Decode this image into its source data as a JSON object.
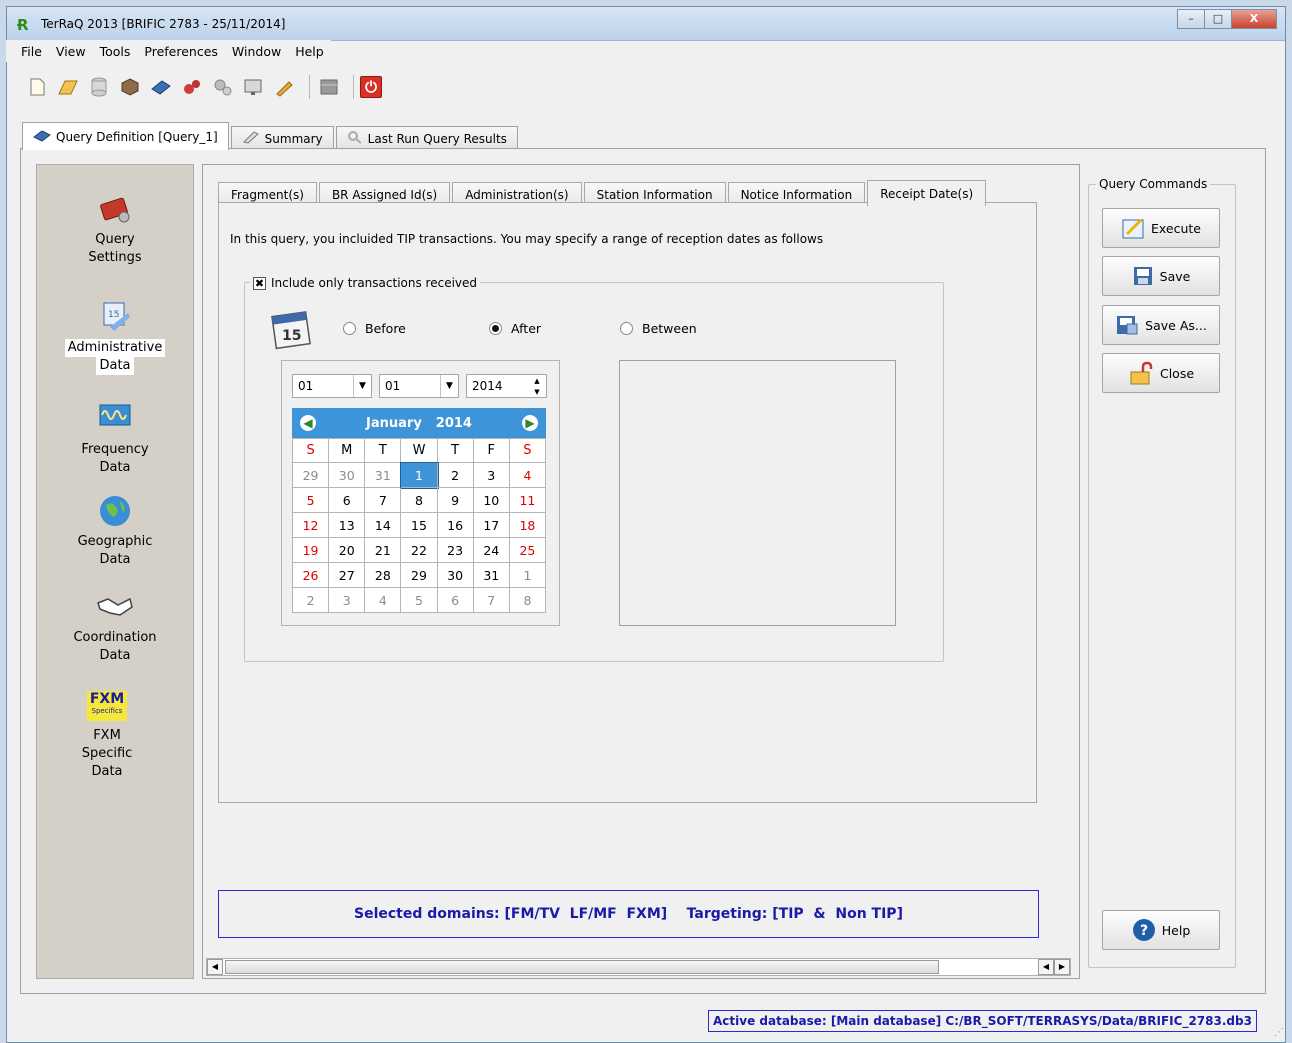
{
  "window": {
    "title": "TerRaQ 2013 [BRIFIC 2783 - 25/11/2014]",
    "controls": [
      "–",
      "□",
      "X"
    ]
  },
  "menu": [
    "File",
    "View",
    "Tools",
    "Preferences",
    "Window",
    "Help"
  ],
  "toolbar_icons": [
    "new-file-icon",
    "open-folder-icon",
    "database-icon",
    "cube-icon",
    "blue-query-icon",
    "red-tools-icon",
    "gears-icon",
    "monitor-icon",
    "pen-icon",
    "grid-icon",
    "power-icon"
  ],
  "main_tabs": [
    {
      "label": "Query Definition [Query_1]",
      "icon": "query-icon"
    },
    {
      "label": "Summary",
      "icon": "summary-icon"
    },
    {
      "label": "Last Run Query Results",
      "icon": "results-icon"
    }
  ],
  "sidebar": {
    "items": [
      {
        "label1": "Query",
        "label2": "Settings"
      },
      {
        "label1": "Administrative",
        "label2": "Data"
      },
      {
        "label1": "Frequency",
        "label2": "Data"
      },
      {
        "label1": "Geographic",
        "label2": "Data"
      },
      {
        "label1": "Coordination",
        "label2": "Data"
      },
      {
        "label1": "FXM",
        "label2": "Specific",
        "label3": "Data",
        "logo": "FXM",
        "logo_sub": "Specifics"
      }
    ]
  },
  "sub_tabs": [
    "Fragment(s)",
    "BR Assigned Id(s)",
    "Administration(s)",
    "Station Information",
    "Notice Information",
    "Receipt Date(s)"
  ],
  "receipt": {
    "intro": "In this query, you incluided TIP transactions. You may specify a range of reception dates as follows",
    "include_label": "Include only transactions received",
    "include_checked": "✖",
    "calendar_icon_text": "15",
    "options": [
      "Before",
      "After",
      "Between"
    ],
    "selected_option": "After",
    "day_combo": "01",
    "month_combo": "01",
    "year_spin": "2014"
  },
  "calendar": {
    "month": "January",
    "year": "2014",
    "weekdays": [
      "S",
      "M",
      "T",
      "W",
      "T",
      "F",
      "S"
    ],
    "weeks": [
      [
        "29",
        "30",
        "31",
        "1",
        "2",
        "3",
        "4"
      ],
      [
        "5",
        "6",
        "7",
        "8",
        "9",
        "10",
        "11"
      ],
      [
        "12",
        "13",
        "14",
        "15",
        "16",
        "17",
        "18"
      ],
      [
        "19",
        "20",
        "21",
        "22",
        "23",
        "24",
        "25"
      ],
      [
        "26",
        "27",
        "28",
        "29",
        "30",
        "31",
        "1"
      ],
      [
        "2",
        "3",
        "4",
        "5",
        "6",
        "7",
        "8"
      ]
    ],
    "selected_day": "1"
  },
  "status": {
    "domains": "Selected domains: [FM/TV  LF/MF  FXM]    Targeting: [TIP  &  Non TIP]"
  },
  "commands": {
    "legend": "Query Commands",
    "execute": "Execute",
    "save": "Save",
    "save_as": "Save As...",
    "close": "Close",
    "help": "Help"
  },
  "db_status": "Active database: [Main database] C:/BR_SOFT/TERRASYS/Data/BRIFIC_2783.db3",
  "colors": {
    "calendar_header": "#3e94d9",
    "weekend_red": "#e00000",
    "status_blue": "#1a1aa8"
  }
}
